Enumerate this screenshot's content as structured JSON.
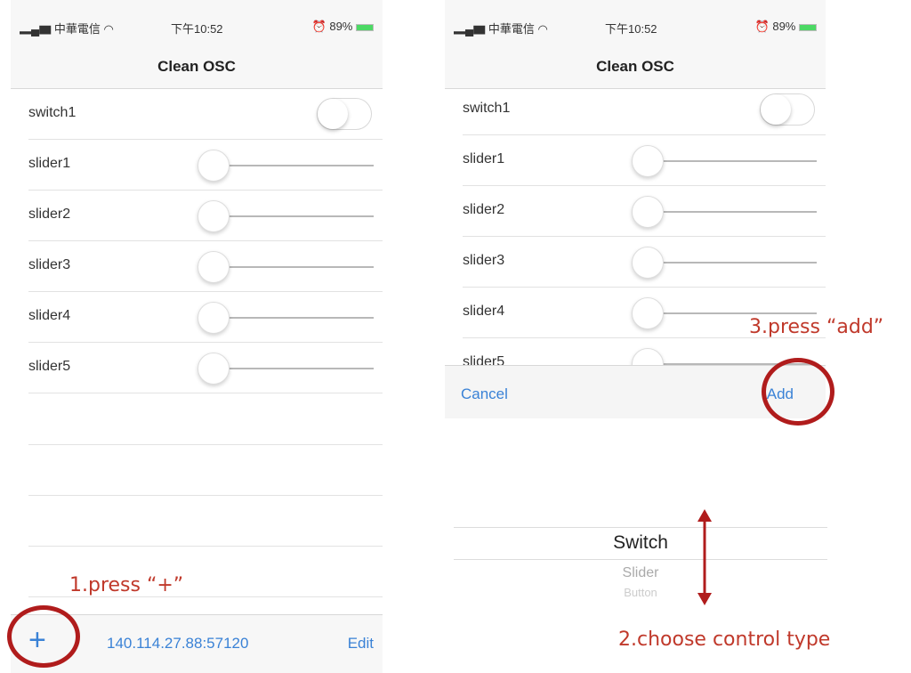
{
  "status_bar": {
    "carrier": "中華電信",
    "time": "下午10:52",
    "battery": "89%"
  },
  "left_screen": {
    "title": "Clean OSC",
    "rows": [
      {
        "type": "switch",
        "label": "switch1",
        "state": "off"
      },
      {
        "type": "slider",
        "label": "slider1",
        "value": 0
      },
      {
        "type": "slider",
        "label": "slider2",
        "value": 0
      },
      {
        "type": "slider",
        "label": "slider3",
        "value": 0
      },
      {
        "type": "slider",
        "label": "slider4",
        "value": 0
      },
      {
        "type": "slider",
        "label": "slider5",
        "value": 0
      }
    ],
    "toolbar": {
      "plus_label": "+",
      "address": "140.114.27.88:57120",
      "edit_label": "Edit"
    }
  },
  "right_screen": {
    "title": "Clean OSC",
    "rows": [
      {
        "type": "switch",
        "label": "switch1",
        "state": "off"
      },
      {
        "type": "slider",
        "label": "slider1",
        "value": 0
      },
      {
        "type": "slider",
        "label": "slider2",
        "value": 0
      },
      {
        "type": "slider",
        "label": "slider3",
        "value": 0
      },
      {
        "type": "slider",
        "label": "slider4",
        "value": 0
      },
      {
        "type": "slider",
        "label": "slider5",
        "value": 0
      }
    ],
    "action_bar": {
      "cancel_label": "Cancel",
      "add_label": "Add"
    },
    "picker": {
      "selected": "Switch",
      "options": [
        "Switch",
        "Slider",
        "Button"
      ]
    }
  },
  "annotations": {
    "step1": "1.press “+”",
    "step2": "2.choose control type",
    "step3": "3.press “add”"
  },
  "colors": {
    "accent": "#3a82d6",
    "annotation": "#c0392b",
    "highlight": "#b01c1c"
  }
}
